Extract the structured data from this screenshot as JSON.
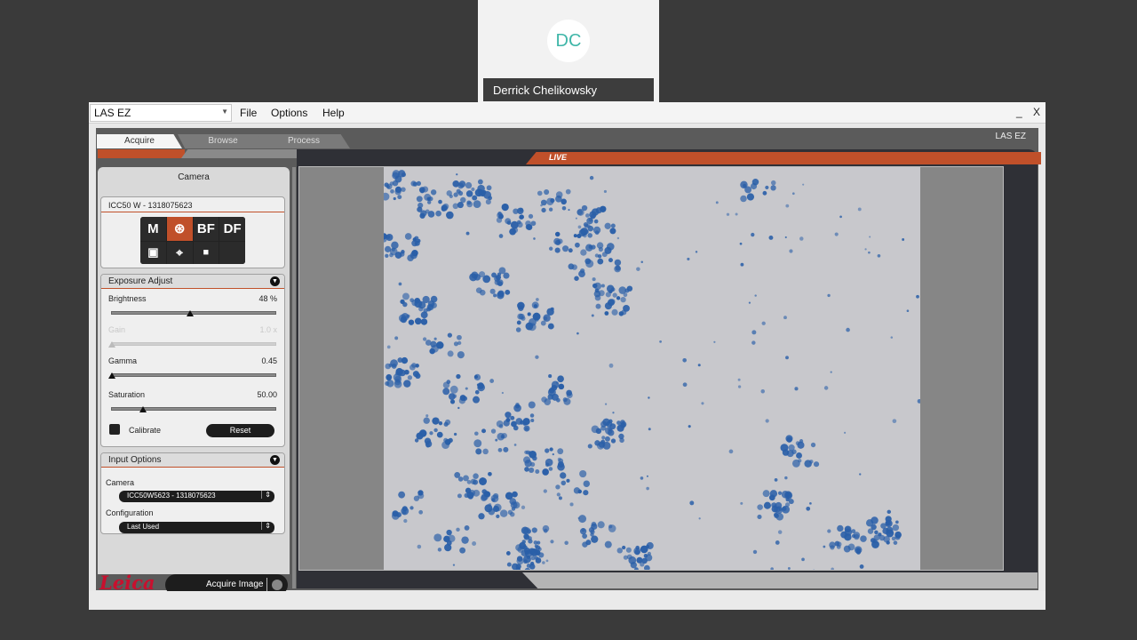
{
  "participant": {
    "initials": "DC",
    "name": "Derrick Chelikowsky"
  },
  "menubar": {
    "app_select": "LAS EZ",
    "items": [
      "File",
      "Options",
      "Help"
    ],
    "minimize": "_",
    "close": "X"
  },
  "tabs": {
    "acquire": "Acquire",
    "browse": "Browse",
    "process": "Process"
  },
  "brand_top": "LAS EZ",
  "live_label": "LIVE",
  "camera_panel": {
    "title": "Camera",
    "camera_model": "ICC50 W - 1318075623",
    "mode_buttons": [
      "M",
      "⊛",
      "BF",
      "DF"
    ],
    "tool_buttons": [
      "▣",
      "⌖",
      "■",
      ""
    ]
  },
  "exposure": {
    "title": "Exposure Adjust",
    "brightness_label": "Brightness",
    "brightness_value": "48 %",
    "brightness_level": 0.48,
    "gain_label": "Gain",
    "gain_value": "1.0 x",
    "gamma_label": "Gamma",
    "gamma_value": "0.45",
    "saturation_label": "Saturation",
    "saturation_value": "50.00",
    "calibrate_label": "Calibrate",
    "reset_label": "Reset"
  },
  "input_options": {
    "title": "Input Options",
    "camera_label": "Camera",
    "camera_value": "ICC50W5623 - 1318075623",
    "configuration_label": "Configuration",
    "configuration_value": "Last Used"
  },
  "logo_text": "Leica",
  "acquire_button": "Acquire Image",
  "colors": {
    "accent": "#c0502a",
    "stain": "#2a5fa8",
    "leica": "#c8102e"
  }
}
